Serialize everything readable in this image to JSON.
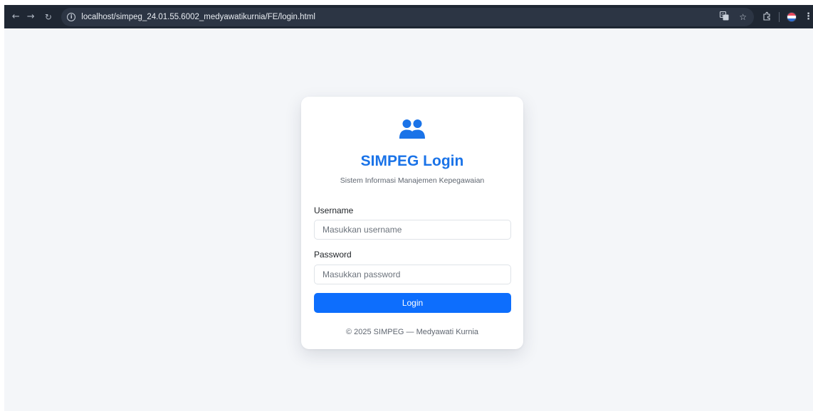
{
  "browser": {
    "url": "localhost/simpeg_24.01.55.6002_medyawatikurnia/FE/login.html",
    "icons": {
      "back": "arrow-left-icon",
      "forward": "arrow-right-icon",
      "reload": "reload-icon",
      "site_info": "info-icon",
      "translate": "translate-icon",
      "bookmark": "star-icon",
      "extensions": "puzzle-icon",
      "profile": "profile-avatar",
      "menu": "kebab-menu-icon"
    }
  },
  "login": {
    "icon": "users-icon",
    "title": "SIMPEG Login",
    "subtitle": "Sistem Informasi Manajemen Kepegawaian",
    "username_label": "Username",
    "username_placeholder": "Masukkan username",
    "username_value": "",
    "password_label": "Password",
    "password_placeholder": "Masukkan password",
    "password_value": "",
    "button_label": "Login",
    "footer": "© 2025 SIMPEG — Medyawati Kurnia"
  },
  "colors": {
    "accent": "#1a73e8",
    "button": "#0d6efd",
    "page_background": "#f4f6f9",
    "toolbar": "#1f2733"
  }
}
